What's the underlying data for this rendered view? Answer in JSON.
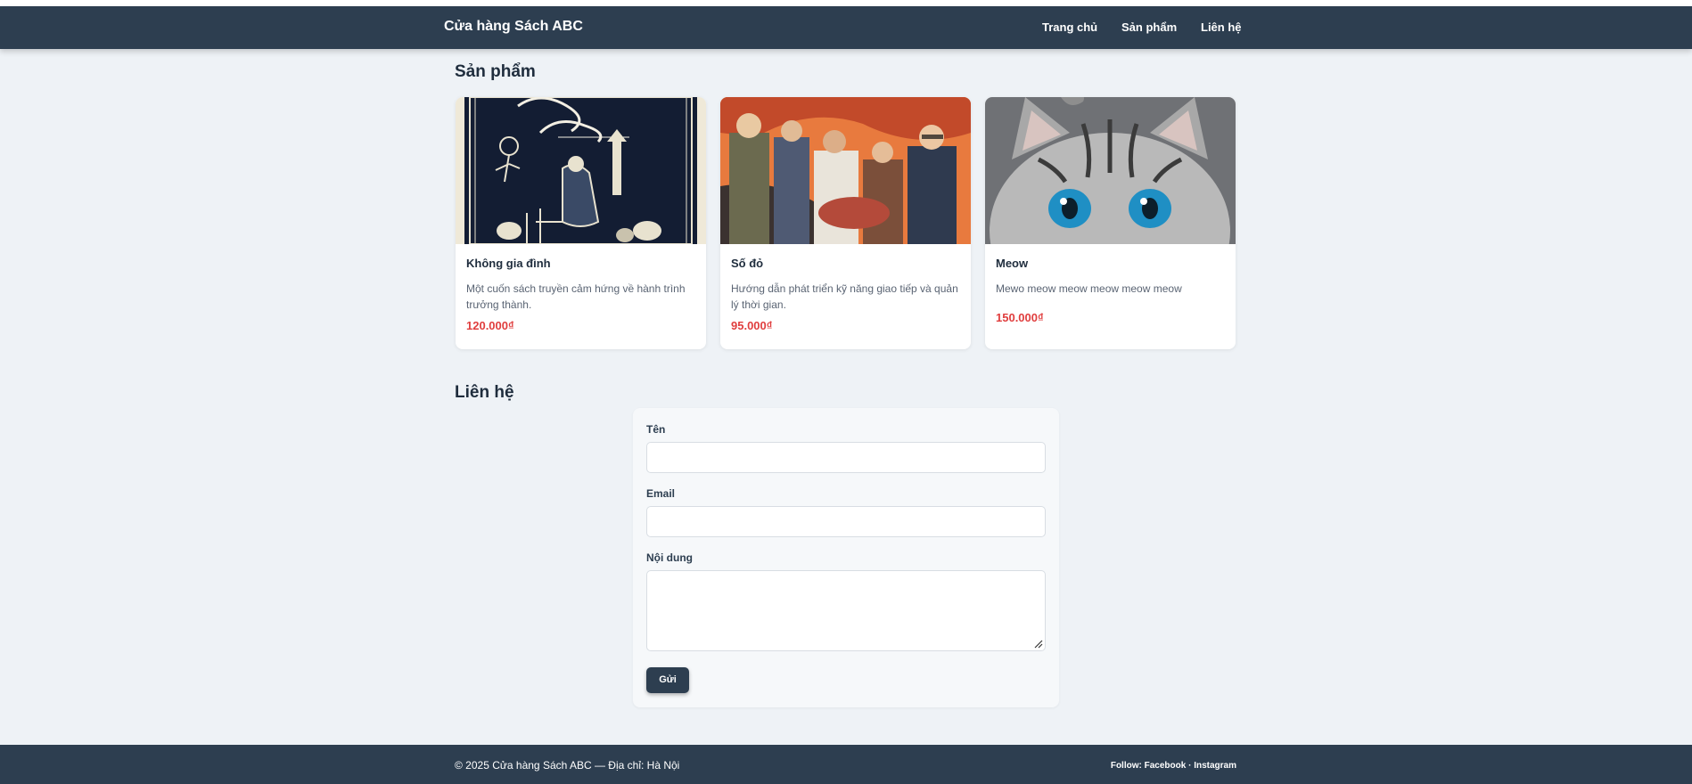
{
  "header": {
    "brand": "Cửa hàng Sách ABC",
    "nav": [
      "Trang chủ",
      "Sản phẩm",
      "Liên hệ"
    ]
  },
  "products": {
    "title": "Sản phẩm",
    "items": [
      {
        "name": "Không gia đình",
        "description": "Một cuốn sách truyền cảm hứng về hành trình trưởng thành.",
        "price": "120.000₫"
      },
      {
        "name": "Số đỏ",
        "description": "Hướng dẫn phát triển kỹ năng giao tiếp và quản lý thời gian.",
        "price": "95.000₫"
      },
      {
        "name": "Meow",
        "description": "Mewo meow meow meow meow meow",
        "price": "150.000₫"
      }
    ]
  },
  "contact": {
    "title": "Liên hệ",
    "name_label": "Tên",
    "email_label": "Email",
    "message_label": "Nội dung",
    "submit_label": "Gửi"
  },
  "footer": {
    "copyright": "© 2025 Cửa hàng Sách ABC — Địa chỉ: Hà Nội",
    "follow_prefix": "Follow: ",
    "facebook": "Facebook",
    "separator": " · ",
    "instagram": "Instagram"
  },
  "colors": {
    "header_bg": "#2d3e50",
    "page_bg": "#eef2f6",
    "price": "#e03e3e"
  }
}
